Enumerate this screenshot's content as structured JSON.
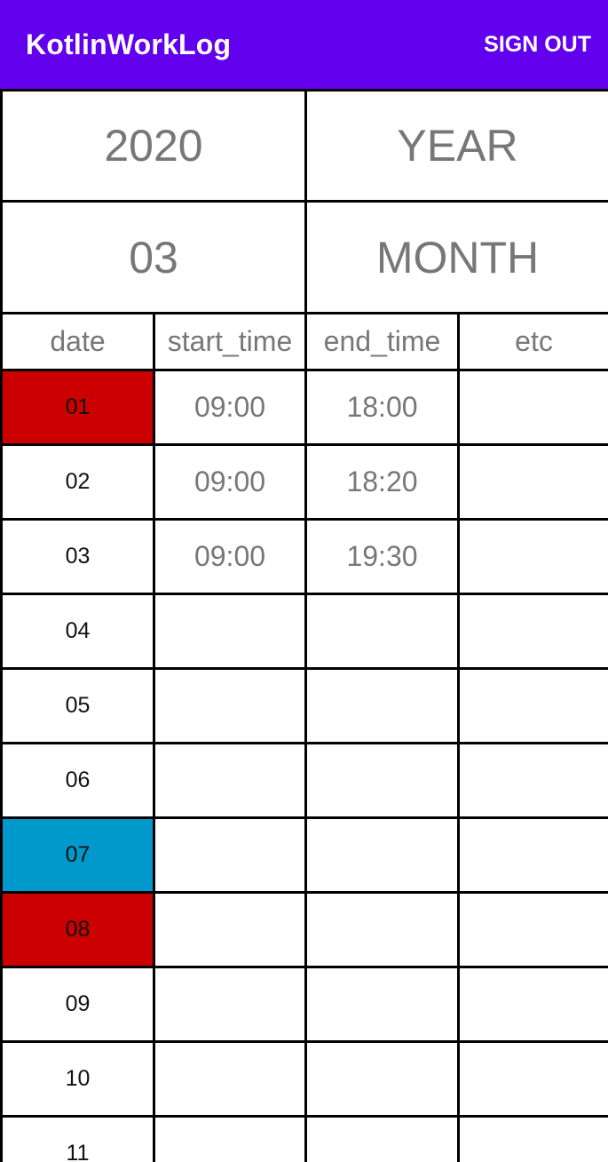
{
  "appbar": {
    "title": "KotlinWorkLog",
    "sign_out_label": "SIGN OUT"
  },
  "selector": {
    "year_value": "2020",
    "year_label": "YEAR",
    "month_value": "03",
    "month_label": "MONTH"
  },
  "table": {
    "headers": [
      "date",
      "start_time",
      "end_time",
      "etc"
    ],
    "rows": [
      {
        "date": "01",
        "start": "09:00",
        "end": "18:00",
        "etc": "",
        "highlight": "red"
      },
      {
        "date": "02",
        "start": "09:00",
        "end": "18:20",
        "etc": "",
        "highlight": ""
      },
      {
        "date": "03",
        "start": "09:00",
        "end": "19:30",
        "etc": "",
        "highlight": ""
      },
      {
        "date": "04",
        "start": "",
        "end": "",
        "etc": "",
        "highlight": ""
      },
      {
        "date": "05",
        "start": "",
        "end": "",
        "etc": "",
        "highlight": ""
      },
      {
        "date": "06",
        "start": "",
        "end": "",
        "etc": "",
        "highlight": ""
      },
      {
        "date": "07",
        "start": "",
        "end": "",
        "etc": "",
        "highlight": "blue"
      },
      {
        "date": "08",
        "start": "",
        "end": "",
        "etc": "",
        "highlight": "red"
      },
      {
        "date": "09",
        "start": "",
        "end": "",
        "etc": "",
        "highlight": ""
      },
      {
        "date": "10",
        "start": "",
        "end": "",
        "etc": "",
        "highlight": ""
      },
      {
        "date": "11",
        "start": "",
        "end": "",
        "etc": "",
        "highlight": ""
      }
    ]
  },
  "colors": {
    "appbar": "#6200ee",
    "holiday_red": "#cc0000",
    "today_blue": "#0099cc"
  }
}
